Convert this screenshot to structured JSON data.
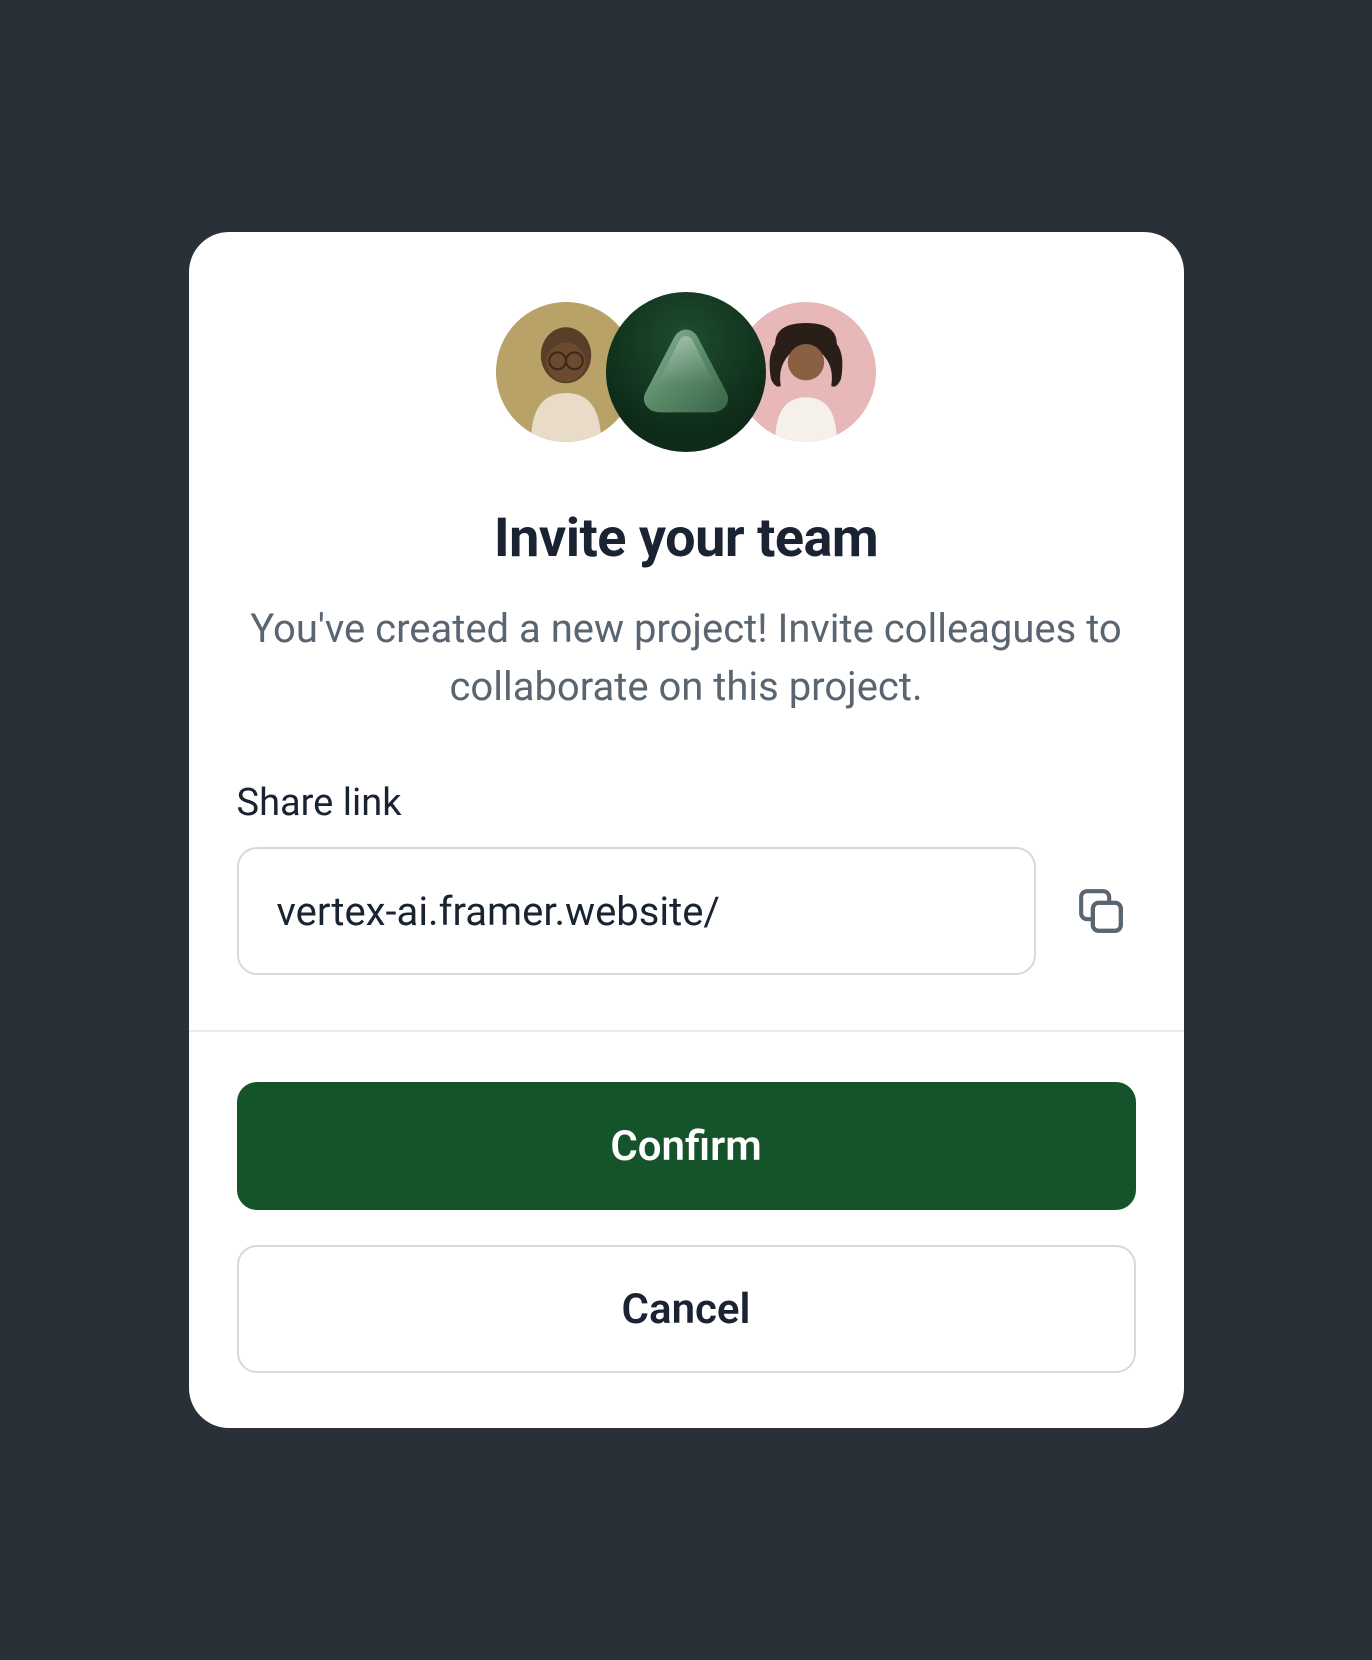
{
  "title": "Invite your team",
  "subtitle": "You've created a new project! Invite colleagues to collaborate on this project.",
  "share": {
    "label": "Share link",
    "value": "vertex-ai.framer.website/"
  },
  "actions": {
    "confirm": "Confirm",
    "cancel": "Cancel"
  },
  "icons": {
    "copy": "copy-icon"
  },
  "avatars": {
    "left": "person-avatar-1",
    "center": "triangle-logo",
    "right": "person-avatar-2"
  },
  "colors": {
    "primary": "#15542a",
    "textDark": "#1a2332",
    "textMuted": "#5a6572",
    "border": "#d5d9de"
  }
}
